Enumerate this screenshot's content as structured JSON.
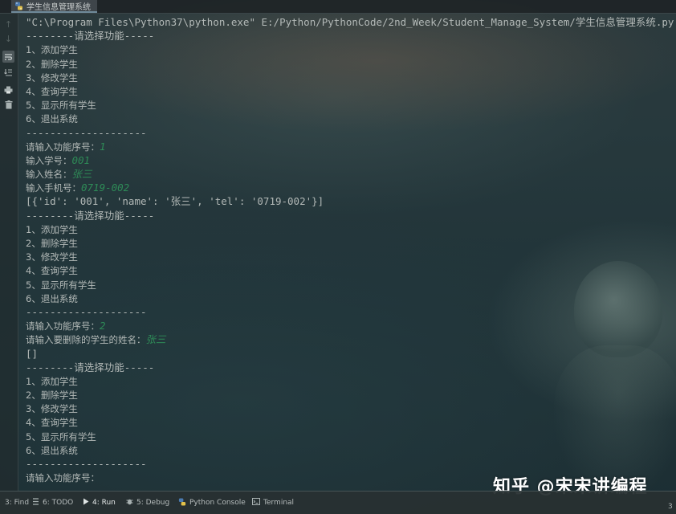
{
  "tab": {
    "title": "学生信息管理系统",
    "icon": "python-icon"
  },
  "gutter": {
    "icons": [
      "arrow-up-icon",
      "arrow-down-icon",
      "soft-wrap-icon",
      "scroll-to-end-icon",
      "print-icon",
      "trash-icon"
    ]
  },
  "console": {
    "lines": [
      {
        "text": "\"C:\\Program Files\\Python37\\python.exe\" E:/Python/PythonCode/2nd_Week/Student_Manage_System/学生信息管理系统.py",
        "style": "mono"
      },
      {
        "text": "--------请选择功能-----",
        "style": "mono"
      },
      {
        "text": "1、添加学生",
        "style": "cn"
      },
      {
        "text": "2、删除学生",
        "style": "cn"
      },
      {
        "text": "3、修改学生",
        "style": "cn"
      },
      {
        "text": "4、查询学生",
        "style": "cn"
      },
      {
        "text": "5、显示所有学生",
        "style": "cn"
      },
      {
        "text": "6、退出系统",
        "style": "cn"
      },
      {
        "text": "--------------------",
        "style": "mono"
      },
      {
        "text": "请输入功能序号：",
        "style": "cn",
        "input": "1"
      },
      {
        "text": "输入学号：",
        "style": "cn",
        "input": "001"
      },
      {
        "text": "输入姓名：",
        "style": "cn",
        "input": "张三"
      },
      {
        "text": "输入手机号：",
        "style": "cn",
        "input": "0719-002"
      },
      {
        "text": "[{'id': '001', 'name': '张三', 'tel': '0719-002'}]",
        "style": "mono"
      },
      {
        "text": "--------请选择功能-----",
        "style": "mono"
      },
      {
        "text": "1、添加学生",
        "style": "cn"
      },
      {
        "text": "2、删除学生",
        "style": "cn"
      },
      {
        "text": "3、修改学生",
        "style": "cn"
      },
      {
        "text": "4、查询学生",
        "style": "cn"
      },
      {
        "text": "5、显示所有学生",
        "style": "cn"
      },
      {
        "text": "6、退出系统",
        "style": "cn"
      },
      {
        "text": "--------------------",
        "style": "mono"
      },
      {
        "text": "请输入功能序号：",
        "style": "cn",
        "input": "2"
      },
      {
        "text": "请输入要删除的学生的姓名：",
        "style": "cn",
        "input": "张三"
      },
      {
        "text": "[]",
        "style": "mono"
      },
      {
        "text": "--------请选择功能-----",
        "style": "mono"
      },
      {
        "text": "1、添加学生",
        "style": "cn"
      },
      {
        "text": "2、删除学生",
        "style": "cn"
      },
      {
        "text": "3、修改学生",
        "style": "cn"
      },
      {
        "text": "4、查询学生",
        "style": "cn"
      },
      {
        "text": "5、显示所有学生",
        "style": "cn"
      },
      {
        "text": "6、退出系统",
        "style": "cn"
      },
      {
        "text": "--------------------",
        "style": "mono"
      },
      {
        "text": "请输入功能序号：",
        "style": "cn"
      }
    ]
  },
  "toolbar": {
    "items": [
      {
        "label": "3: Find",
        "icon": "search-icon"
      },
      {
        "label": "6: TODO",
        "icon": "todo-icon"
      },
      {
        "label": "4: Run",
        "icon": "run-icon",
        "active": true
      },
      {
        "label": "5: Debug",
        "icon": "debug-icon"
      },
      {
        "label": "Python Console",
        "icon": "python-console-icon"
      },
      {
        "label": "Terminal",
        "icon": "terminal-icon"
      }
    ]
  },
  "watermark": "知乎 @宋宋讲编程",
  "corner_number": "3",
  "colors": {
    "input_text": "#2e8b57",
    "console_text": "#b3b9b7"
  }
}
